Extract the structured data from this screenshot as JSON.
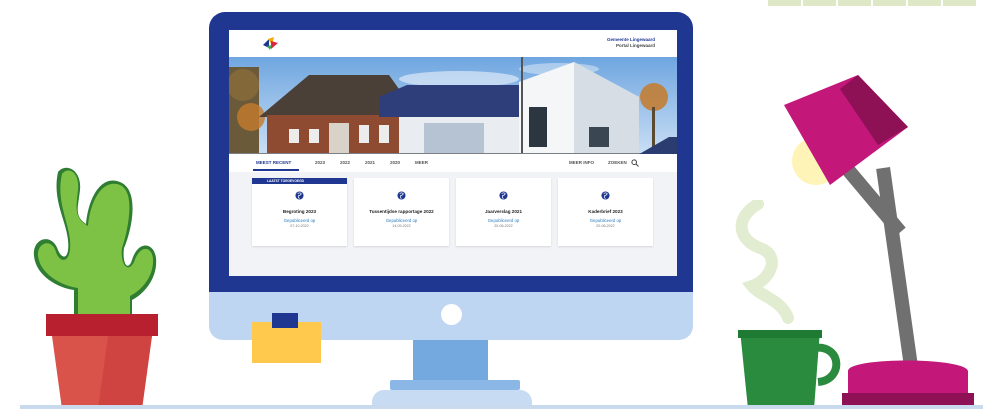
{
  "site": {
    "org_line1": "Gemeente Lingewaard",
    "org_line2": "Portal Lingewaard"
  },
  "tabs": [
    {
      "label": "MEEST RECENT",
      "active": true
    },
    {
      "label": "2023",
      "active": false
    },
    {
      "label": "2022",
      "active": false
    },
    {
      "label": "2021",
      "active": false
    },
    {
      "label": "2020",
      "active": false
    },
    {
      "label": "MEER",
      "active": false
    }
  ],
  "tab_actions": {
    "more_info": "MEER INFO",
    "search": "ZOEKEN",
    "search_icon": "search-icon"
  },
  "cards": [
    {
      "ribbon": "LAATST TOEGEVOEGD",
      "title": "Begroting 2023",
      "published": "Gepubliceerd op",
      "date": "07-10-2022",
      "icon": "globe-icon"
    },
    {
      "ribbon": "",
      "title": "Tussentijdse rapportage 2022",
      "published": "Gepubliceerd op",
      "date": "14-09-2022",
      "icon": "globe-icon"
    },
    {
      "ribbon": "",
      "title": "Jaarverslag 2021",
      "published": "Gepubliceerd op",
      "date": "20-06-2022",
      "icon": "globe-icon"
    },
    {
      "ribbon": "",
      "title": "Kaderbrief 2023",
      "published": "Gepubliceerd op",
      "date": "20-06-2022",
      "icon": "globe-icon"
    }
  ],
  "colors": {
    "brand_blue": "#1f3791",
    "link_blue": "#2a7bbf",
    "lamp_magenta": "#b0146d",
    "cactus_green": "#7dc244",
    "pot_red": "#d9534a",
    "mug_green": "#2a8a3e",
    "sticky_yellow": "#ffc94d"
  }
}
